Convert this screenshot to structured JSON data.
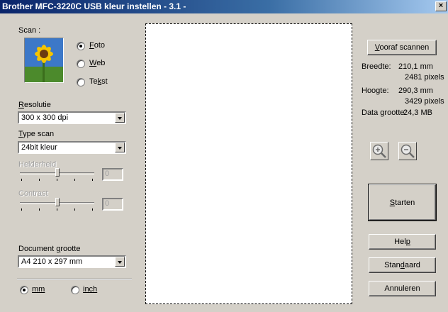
{
  "window": {
    "title": "Brother MFC-3220C USB kleur instellen - 3.1 -",
    "close_glyph": "×"
  },
  "scan": {
    "label": "Scan :",
    "options": [
      {
        "label": "Foto",
        "selected": true
      },
      {
        "label": "Web",
        "selected": false
      },
      {
        "label": "Tekst",
        "selected": false
      }
    ]
  },
  "resolution": {
    "label": "Resolutie",
    "value": "300 x 300 dpi"
  },
  "scan_type": {
    "label": "Type scan",
    "value": "24bit kleur"
  },
  "brightness": {
    "label": "Helderheid",
    "value": "0",
    "level": 0.5,
    "enabled": false
  },
  "contrast": {
    "label": "Contrast",
    "value": "0",
    "level": 0.5,
    "enabled": false
  },
  "document_size": {
    "label": "Document grootte",
    "value": "A4 210 x 297 mm"
  },
  "units": {
    "mm_label": "mm",
    "inch_label": "inch",
    "selected": "mm"
  },
  "prescan_button": "Vooraf scannen",
  "info": {
    "width_label": "Breedte:",
    "width_mm": "210,1 mm",
    "width_px": "2481 pixels",
    "height_label": "Hoogte:",
    "height_mm": "290,3 mm",
    "height_px": "3429 pixels",
    "data_size_label": "Data grootte:",
    "data_size_value": "24,3 MB"
  },
  "buttons": {
    "start": "Starten",
    "help": "Help",
    "default": "Standaard",
    "cancel": "Annuleren"
  },
  "colors": {
    "titlebar_start": "#0a246a",
    "titlebar_end": "#a6caf0",
    "dialog_bg": "#d4d0c8"
  }
}
